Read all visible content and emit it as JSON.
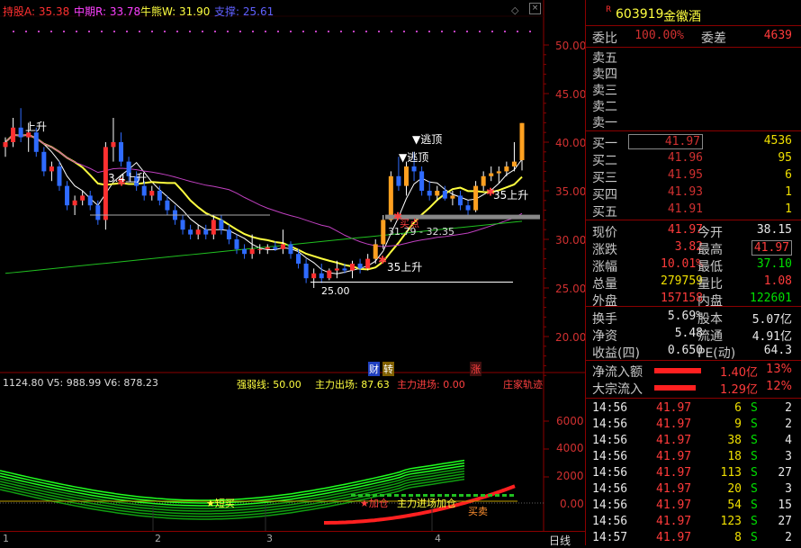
{
  "header": {
    "holding_label": "持股A: 35.38",
    "mid_label": "中期R: 33.78",
    "bull_label": "牛熊W: 31.90",
    "support_label": "支撑: 25.61"
  },
  "y_axis_main": [
    "50.00",
    "45.00",
    "40.00",
    "35.00",
    "30.00",
    "25.00",
    "20.00"
  ],
  "y_axis_sub": [
    "6000",
    "4000",
    "2000",
    "0.00"
  ],
  "annotations": {
    "rise1": "上升",
    "low_left": "3.4上升",
    "escape1": "▼逃顶",
    "escape2": "▼逃顶",
    "rise_35a": "35上升",
    "rise_35b": "35上升",
    "range": "31.79 - 32.35",
    "support": "25.00",
    "buy_dot": "买点",
    "cai": "财",
    "zhuan": "转",
    "zhang": "涨"
  },
  "sub_header": {
    "v_values": "1124.80  V5: 988.99  V6: 878.23",
    "strength": "强弱线: 50.00",
    "main_out": "主力出场: 87.63",
    "main_in": "主力进场: 0.00",
    "dealer": "庄家轨迹"
  },
  "sub_annotations": {
    "short_buy": "★短买",
    "add_pos": "★加仓",
    "main_entry": "主力进场加仓",
    "buy_sell": "买卖"
  },
  "x_ticks": [
    "1",
    "2",
    "3",
    "4"
  ],
  "tab": {
    "day_line": "日线"
  },
  "stock": {
    "r_mark": "R",
    "code": "603919",
    "name": "金徽酒"
  },
  "order_book": {
    "ratio_label": "委比",
    "ratio_value": "100.00%",
    "diff_label": "委差",
    "diff_value": "4639",
    "sells": [
      {
        "label": "卖五",
        "price": "",
        "vol": ""
      },
      {
        "label": "卖四",
        "price": "",
        "vol": ""
      },
      {
        "label": "卖三",
        "price": "",
        "vol": ""
      },
      {
        "label": "卖二",
        "price": "",
        "vol": ""
      },
      {
        "label": "卖一",
        "price": "",
        "vol": ""
      }
    ],
    "buys": [
      {
        "label": "买一",
        "price": "41.97",
        "vol": "4536"
      },
      {
        "label": "买二",
        "price": "41.96",
        "vol": "95"
      },
      {
        "label": "买三",
        "price": "41.95",
        "vol": "6"
      },
      {
        "label": "买四",
        "price": "41.93",
        "vol": "1"
      },
      {
        "label": "买五",
        "price": "41.91",
        "vol": "1"
      }
    ]
  },
  "quote": [
    {
      "l1": "现价",
      "v1": "41.97",
      "l2": "今开",
      "v2": "38.15",
      "c2": "wht"
    },
    {
      "l1": "涨跌",
      "v1": "3.82",
      "l2": "最高",
      "v2": "41.97",
      "c2": "red"
    },
    {
      "l1": "涨幅",
      "v1": "10.01%",
      "l2": "最低",
      "v2": "37.10",
      "c2": "grn"
    },
    {
      "l1": "总量",
      "v1": "279759",
      "l2": "量比",
      "v2": "1.08",
      "c2": "red"
    },
    {
      "l1": "外盘",
      "v1": "157158",
      "l2": "内盘",
      "v2": "122601",
      "c2": "grn"
    }
  ],
  "fundamentals": [
    {
      "l1": "换手",
      "v1": "5.69%",
      "l2": "股本",
      "v2": "5.07亿"
    },
    {
      "l1": "净资",
      "v1": "5.48",
      "l2": "流通",
      "v2": "4.91亿"
    },
    {
      "l1": "收益(四)",
      "v1": "0.650",
      "l2": "PE(动)",
      "v2": "64.3"
    }
  ],
  "flows": [
    {
      "label": "净流入额",
      "value": "1.40亿",
      "pct": "13%"
    },
    {
      "label": "大宗流入",
      "value": "1.29亿",
      "pct": "12%"
    }
  ],
  "ticks": [
    {
      "time": "14:56",
      "price": "41.97",
      "vol": "6",
      "side": "S",
      "n": "2"
    },
    {
      "time": "14:56",
      "price": "41.97",
      "vol": "9",
      "side": "S",
      "n": "2"
    },
    {
      "time": "14:56",
      "price": "41.97",
      "vol": "38",
      "side": "S",
      "n": "4"
    },
    {
      "time": "14:56",
      "price": "41.97",
      "vol": "18",
      "side": "S",
      "n": "3"
    },
    {
      "time": "14:56",
      "price": "41.97",
      "vol": "113",
      "side": "S",
      "n": "27"
    },
    {
      "time": "14:56",
      "price": "41.97",
      "vol": "20",
      "side": "S",
      "n": "3"
    },
    {
      "time": "14:56",
      "price": "41.97",
      "vol": "54",
      "side": "S",
      "n": "15"
    },
    {
      "time": "14:56",
      "price": "41.97",
      "vol": "123",
      "side": "S",
      "n": "27"
    },
    {
      "time": "14:57",
      "price": "41.97",
      "vol": "8",
      "side": "S",
      "n": "2"
    }
  ],
  "colors": {
    "up": "#ff3030",
    "down": "#2f6bff",
    "ma_yellow": "#ffff40",
    "ma_magenta": "#c040c0",
    "ma_green": "#20c020",
    "bg": "#000000",
    "grid": "#8b0000"
  },
  "chart_data": {
    "type": "candlestick",
    "ylim": [
      17,
      53
    ],
    "candles": [
      [
        39.5,
        40.5,
        38.5,
        40.0
      ],
      [
        40.0,
        42.5,
        39.5,
        41.5
      ],
      [
        41.5,
        43.5,
        40.0,
        40.5
      ],
      [
        40.5,
        42.0,
        39.0,
        41.0
      ],
      [
        41.0,
        41.5,
        38.5,
        39.0
      ],
      [
        39.0,
        39.5,
        36.5,
        37.0
      ],
      [
        37.0,
        38.0,
        36.0,
        37.5
      ],
      [
        37.5,
        38.0,
        35.0,
        35.5
      ],
      [
        35.5,
        36.0,
        33.0,
        33.5
      ],
      [
        33.5,
        34.5,
        32.5,
        34.0
      ],
      [
        34.0,
        35.0,
        33.5,
        34.5
      ],
      [
        34.5,
        35.0,
        33.0,
        33.5
      ],
      [
        33.5,
        34.0,
        31.5,
        32.0
      ],
      [
        32.0,
        40.0,
        31.0,
        39.5
      ],
      [
        39.5,
        42.5,
        38.0,
        40.0
      ],
      [
        40.0,
        41.0,
        37.5,
        38.0
      ],
      [
        38.0,
        38.5,
        36.0,
        36.5
      ],
      [
        36.5,
        37.0,
        35.0,
        35.5
      ],
      [
        35.5,
        36.0,
        34.0,
        34.5
      ],
      [
        34.5,
        35.5,
        34.0,
        35.0
      ],
      [
        35.0,
        35.5,
        33.5,
        34.0
      ],
      [
        34.0,
        34.5,
        32.5,
        33.0
      ],
      [
        33.0,
        33.5,
        31.5,
        32.0
      ],
      [
        32.0,
        32.5,
        30.5,
        31.0
      ],
      [
        31.0,
        31.5,
        30.0,
        30.5
      ],
      [
        30.5,
        31.5,
        30.0,
        31.0
      ],
      [
        31.0,
        31.5,
        30.0,
        30.5
      ],
      [
        30.5,
        32.5,
        30.0,
        32.0
      ],
      [
        32.0,
        32.5,
        30.5,
        31.0
      ],
      [
        31.0,
        31.5,
        29.5,
        30.0
      ],
      [
        30.0,
        30.5,
        28.5,
        29.0
      ],
      [
        29.0,
        29.5,
        28.0,
        28.5
      ],
      [
        28.5,
        30.5,
        28.0,
        29.0
      ],
      [
        29.0,
        29.5,
        28.5,
        29.0
      ],
      [
        29.0,
        29.5,
        28.5,
        29.2
      ],
      [
        29.2,
        29.8,
        28.8,
        29.0
      ],
      [
        29.0,
        31.0,
        28.5,
        29.5
      ],
      [
        29.5,
        29.8,
        28.0,
        28.5
      ],
      [
        28.5,
        29.0,
        27.0,
        27.5
      ],
      [
        27.5,
        28.0,
        25.5,
        26.0
      ],
      [
        26.0,
        27.0,
        25.0,
        26.5
      ],
      [
        26.5,
        27.5,
        25.5,
        26.0
      ],
      [
        26.0,
        27.0,
        25.8,
        26.8
      ],
      [
        26.8,
        27.8,
        26.0,
        27.0
      ],
      [
        27.0,
        27.5,
        26.5,
        26.8
      ],
      [
        26.8,
        27.8,
        26.0,
        27.5
      ],
      [
        27.5,
        28.0,
        26.5,
        27.0
      ],
      [
        27.0,
        28.5,
        26.8,
        28.0
      ],
      [
        28.0,
        30.0,
        27.5,
        29.5
      ],
      [
        29.5,
        32.5,
        29.0,
        32.0
      ],
      [
        32.0,
        37.0,
        31.8,
        36.5
      ],
      [
        36.5,
        38.5,
        35.0,
        35.5
      ],
      [
        35.5,
        38.0,
        34.5,
        37.5
      ],
      [
        37.5,
        39.0,
        36.0,
        37.0
      ],
      [
        37.0,
        37.5,
        34.5,
        35.0
      ],
      [
        35.0,
        36.0,
        34.0,
        34.5
      ],
      [
        34.5,
        35.5,
        34.0,
        35.0
      ],
      [
        35.0,
        35.5,
        34.0,
        34.2
      ],
      [
        34.2,
        35.0,
        33.5,
        34.5
      ],
      [
        34.5,
        35.0,
        33.0,
        33.5
      ],
      [
        33.5,
        34.0,
        32.5,
        33.0
      ],
      [
        33.0,
        36.0,
        32.8,
        35.5
      ],
      [
        35.5,
        37.0,
        35.0,
        36.5
      ],
      [
        36.5,
        37.5,
        36.0,
        36.8
      ],
      [
        36.8,
        37.5,
        35.8,
        37.0
      ],
      [
        37.0,
        38.0,
        36.5,
        37.5
      ],
      [
        37.5,
        40.0,
        37.0,
        38.0
      ],
      [
        38.15,
        41.97,
        37.1,
        41.97
      ]
    ]
  }
}
